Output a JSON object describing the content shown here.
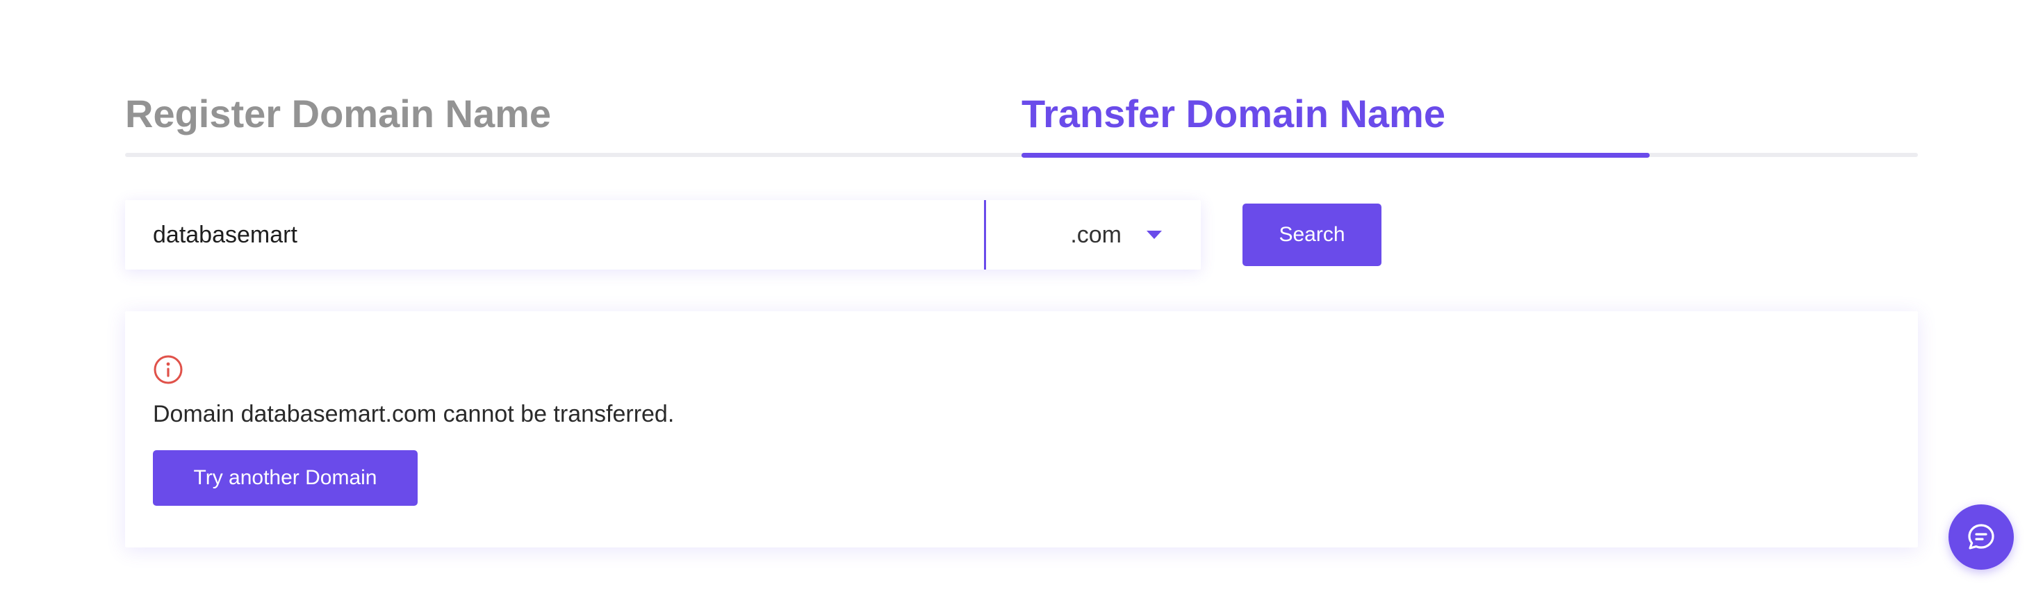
{
  "tabs": {
    "register_label": "Register Domain Name",
    "transfer_label": "Transfer Domain Name",
    "active": "transfer"
  },
  "search": {
    "query_value": "databasemart",
    "tld_value": ".com",
    "button_label": "Search"
  },
  "result": {
    "icon": "info-circle-icon",
    "message": "Domain databasemart.com cannot be transferred.",
    "button_label": "Try another Domain"
  },
  "chat": {
    "icon": "chat-bubble-icon"
  },
  "colors": {
    "accent": "#6a4bea",
    "inactive_tab": "#939393",
    "error_icon": "#e0524a"
  }
}
